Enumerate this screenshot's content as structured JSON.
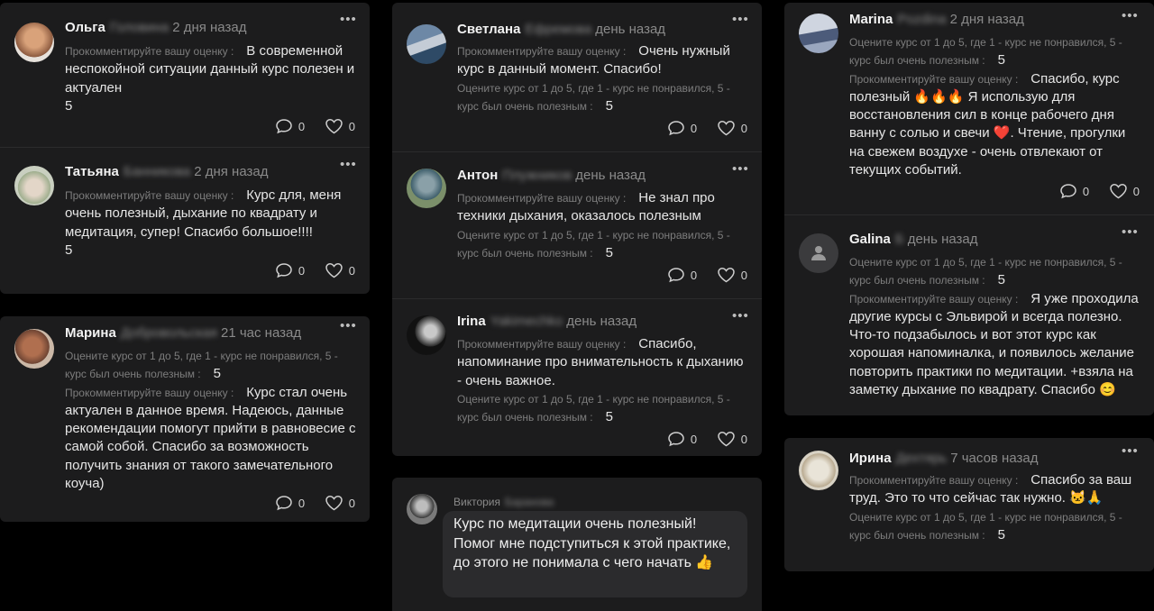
{
  "labels": {
    "comment_prompt": "Прокомментируйте вашу оценку :",
    "rate_prompt": "Оцените курс от 1 до 5, где 1 - курс не понравился, 5 -",
    "rate_prompt_cont": "курс был очень полезным :",
    "more": "•••"
  },
  "reviews": [
    {
      "name": "Ольга",
      "surname": "Головина",
      "time": "2 дня назад",
      "comment": "В современной неспокойной ситуации данный курс полезен и актуален",
      "rating": "5",
      "comments": "0",
      "likes": "0"
    },
    {
      "name": "Татьяна",
      "surname": "Банникова",
      "time": "2 дня назад",
      "comment": "Курс для, меня очень полезный, дыхание по квадрату и медитация, супер! Спасибо большое!!!!",
      "rating": "5",
      "comments": "0",
      "likes": "0"
    },
    {
      "name": "Марина",
      "surname": "Добровольская",
      "time": "21 час назад",
      "rating": "5",
      "comment": "Курс стал очень актуален в данное время. Надеюсь, данные рекомендации помогут прийти в равновесие с самой собой. Спасибо за возможность получить знания от такого замечательного коуча)",
      "comments": "0",
      "likes": "0"
    },
    {
      "name": "Светлана",
      "surname": "Ефремова",
      "time": "день назад",
      "comment": "Очень нужный курс в данный момент. Спасибо!",
      "rating": "5",
      "comments": "0",
      "likes": "0"
    },
    {
      "name": "Антон",
      "surname": "Плужников",
      "time": "день назад",
      "comment": "Не знал про техники дыхания, оказалось полезным",
      "rating": "5",
      "comments": "0",
      "likes": "0"
    },
    {
      "name": "Irina",
      "surname": "Yakimechko",
      "time": "день назад",
      "comment": "Спасибо, напоминание про внимательность к дыханию - очень важное.",
      "rating": "5",
      "comments": "0",
      "likes": "0"
    },
    {
      "name": "Marina",
      "surname": "Pozdina",
      "time": "2 дня назад",
      "rating": "5",
      "comment": "Спасибо, курс полезный 🔥🔥🔥 Я использую для восстановления сил в конце рабочего дня ванну с солью и свечи ❤️. Чтение, прогулки на свежем воздухе - очень отвлекают от текущих событий.",
      "comments": "0",
      "likes": "0"
    },
    {
      "name": "Galina",
      "surname": "Б",
      "time": "день назад",
      "rating": "5",
      "comment": "Я уже проходила другие курсы с Эльвирой и всегда полезно. Что-то подзабылось и вот этот курс как хорошая напоминалка, и появилось желание повторить практики по медитации. +взяла на заметку дыхание по квадрату. Спасибо 😊"
    },
    {
      "name": "Ирина",
      "surname": "Дехтярь",
      "time": "7 часов назад",
      "comment": "Спасибо за ваш труд. Это то что сейчас так нужно. 🐱🙏",
      "rating": "5"
    }
  ],
  "viktoria": {
    "name": "Виктория",
    "surname": "Баранова",
    "message": "Курс по медитации очень полезный! Помог мне подступиться к этой практике, до этого не понимала с чего начать 👍"
  },
  "colors": {
    "card": "#1c1c1d",
    "background": "#000000",
    "muted": "#8a8a8a"
  }
}
